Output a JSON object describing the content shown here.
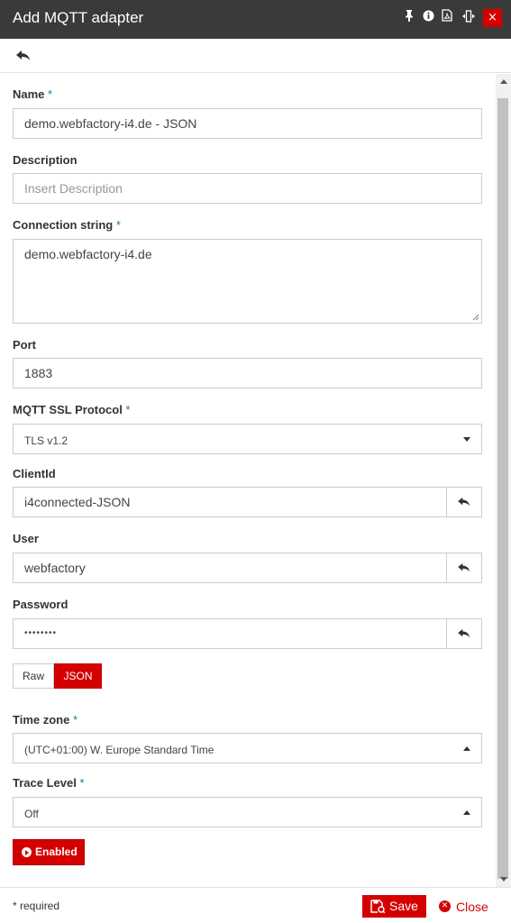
{
  "window": {
    "title": "Add MQTT adapter",
    "icons": [
      "pin-icon",
      "info-icon",
      "pdf-icon",
      "resize-icon",
      "close-icon"
    ],
    "close_glyph": "×"
  },
  "form": {
    "required_marker": "*",
    "name": {
      "label": "Name",
      "value": "demo.webfactory-i4.de - JSON"
    },
    "description": {
      "label": "Description",
      "placeholder": "Insert Description"
    },
    "connection_string": {
      "label": "Connection string",
      "value": "demo.webfactory-i4.de"
    },
    "port": {
      "label": "Port",
      "value": "1883"
    },
    "ssl_protocol": {
      "label": "MQTT SSL Protocol",
      "selected": "TLS v1.2"
    },
    "client_id": {
      "label": "ClientId",
      "value": "i4connected-JSON"
    },
    "user": {
      "label": "User",
      "value": "webfactory"
    },
    "password": {
      "label": "Password",
      "value": "••••••••"
    },
    "format_toggle": {
      "raw_label": "Raw",
      "json_label": "JSON",
      "selected": "JSON"
    },
    "time_zone": {
      "label": "Time zone",
      "selected": "(UTC+01:00) W. Europe Standard Time"
    },
    "trace_level": {
      "label": "Trace Level",
      "selected": "Off"
    },
    "enabled_button": {
      "label": "Enabled"
    }
  },
  "footer": {
    "required_note": "* required",
    "save_label": "Save",
    "close_label": "Close"
  },
  "colors": {
    "accent": "#d40000",
    "titlebar": "#3a3a3a",
    "required_marker": "#1f7aa0"
  }
}
